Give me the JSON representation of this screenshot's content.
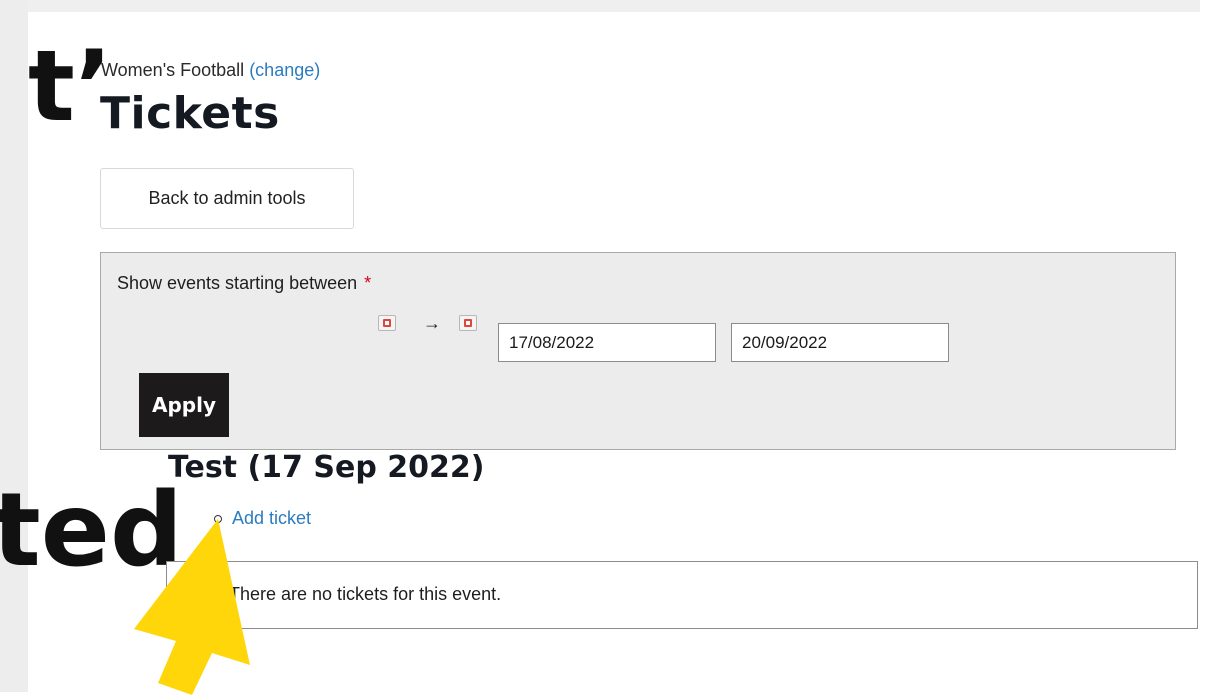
{
  "overlay": {
    "fragment_top": "t’",
    "fragment_bottom": "ted"
  },
  "header": {
    "context_name": "Women's Football",
    "change_link": "(change)",
    "title": "Tickets"
  },
  "toolbar": {
    "back_label": "Back to admin tools"
  },
  "filter": {
    "label": "Show events starting between",
    "required_mark": "*",
    "range_separator": "→",
    "date_from": "17/08/2022",
    "date_to": "20/09/2022",
    "apply_label": "Apply"
  },
  "event": {
    "title": "Test (17 Sep 2022)",
    "add_ticket_label": "Add ticket",
    "empty_message": "There are no tickets for this event."
  },
  "colors": {
    "link": "#2b7bbf",
    "pointer_arrow": "#ffd60a",
    "required": "#d0021b",
    "apply_bg": "#1c1a1a"
  },
  "icons": {
    "calendar": "calendar-icon",
    "pointer": "yellow-pointer-arrow"
  }
}
